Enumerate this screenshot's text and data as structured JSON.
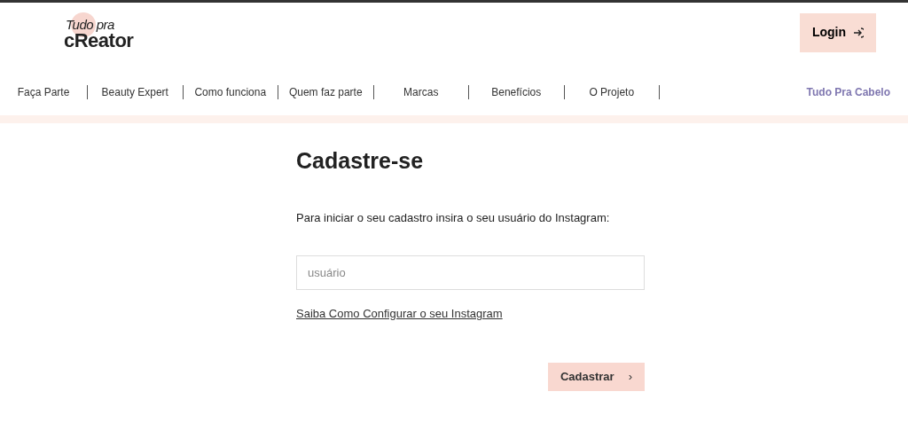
{
  "logo": {
    "line_1": "Tudo pra",
    "line_2": "cReator"
  },
  "login_button": {
    "label": "Login"
  },
  "nav": {
    "items": [
      {
        "label": "Faça Parte"
      },
      {
        "label": "Beauty Expert"
      },
      {
        "label": "Como funciona"
      },
      {
        "label": "Quem faz parte"
      },
      {
        "label": "Marcas"
      },
      {
        "label": "Benefícios"
      },
      {
        "label": "O Projeto"
      }
    ],
    "right_link": "Tudo Pra Cabelo"
  },
  "form": {
    "title": "Cadastre-se",
    "instruction": "Para iniciar o seu cadastro insira o seu usuário do Instagram:",
    "field": {
      "placeholder": "usuário"
    },
    "help_link": "Saiba Como Configurar o seu Instagram",
    "submit": {
      "label": "Cadastrar",
      "icon": "›"
    }
  }
}
